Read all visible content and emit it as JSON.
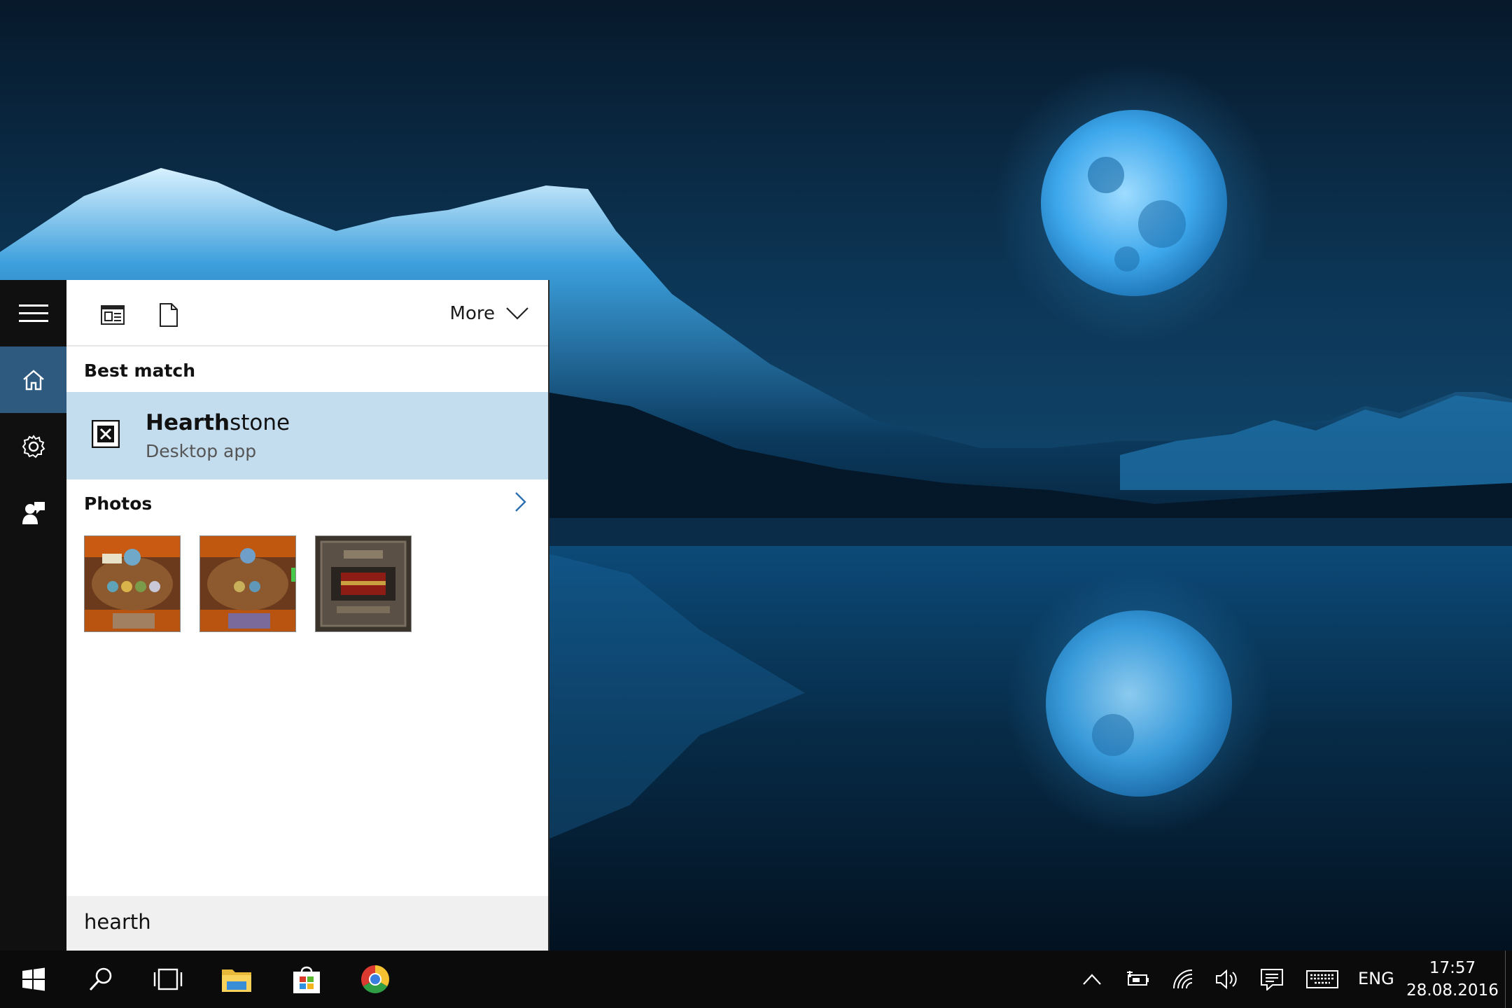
{
  "filter_bar": {
    "apps_icon": "apps-filter-icon",
    "documents_icon": "documents-filter-icon",
    "more_label": "More"
  },
  "nav_rail": {
    "items": [
      "menu-icon",
      "home-icon",
      "settings-icon",
      "feedback-icon"
    ]
  },
  "best_match": {
    "header": "Best match",
    "app_name_match": "Hearth",
    "app_name_rest": "stone",
    "app_type": "Desktop app",
    "icon": "broken-app-icon"
  },
  "photos": {
    "header": "Photos",
    "thumbnails": [
      "hearthstone-board-1",
      "hearthstone-board-2",
      "hearthstone-pack"
    ]
  },
  "search": {
    "query": "hearth"
  },
  "taskbar": {
    "icons": [
      "windows-start-icon",
      "search-icon",
      "task-view-icon",
      "file-explorer-icon",
      "store-icon",
      "chrome-icon"
    ],
    "tray": [
      "chevron-up-icon",
      "battery-icon",
      "wifi-icon",
      "volume-icon",
      "action-center-icon",
      "keyboard-icon"
    ],
    "language": "ENG",
    "time": "17:57",
    "date": "28.08.2016"
  },
  "colors": {
    "selected_item": "#c3ddef",
    "active_rail": "#2d5a7e",
    "taskbar": "#0b0b0b"
  }
}
